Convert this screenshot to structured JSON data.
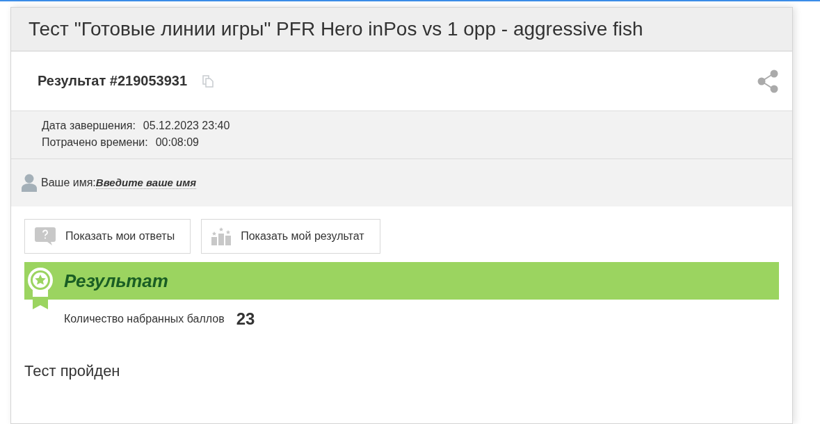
{
  "title": "Тест \"Готовые линии игры\" PFR Hero inPos vs 1 opp - aggressive fish",
  "result": {
    "label": "Результат #219053931"
  },
  "info": [
    {
      "label": "Дата завершения:",
      "value": "05.12.2023 23:40"
    },
    {
      "label": "Потрачено времени:",
      "value": "00:08:09"
    }
  ],
  "name": {
    "label": "Ваше имя:",
    "placeholder": "Введите ваше имя"
  },
  "buttons": [
    {
      "kind": "answers",
      "label": "Показать мои ответы"
    },
    {
      "kind": "result",
      "label": "Показать мой результат"
    }
  ],
  "result_banner": {
    "title": "Результат",
    "score_label": "Количество набранных баллов",
    "score": "23"
  },
  "status": "Тест пройден"
}
